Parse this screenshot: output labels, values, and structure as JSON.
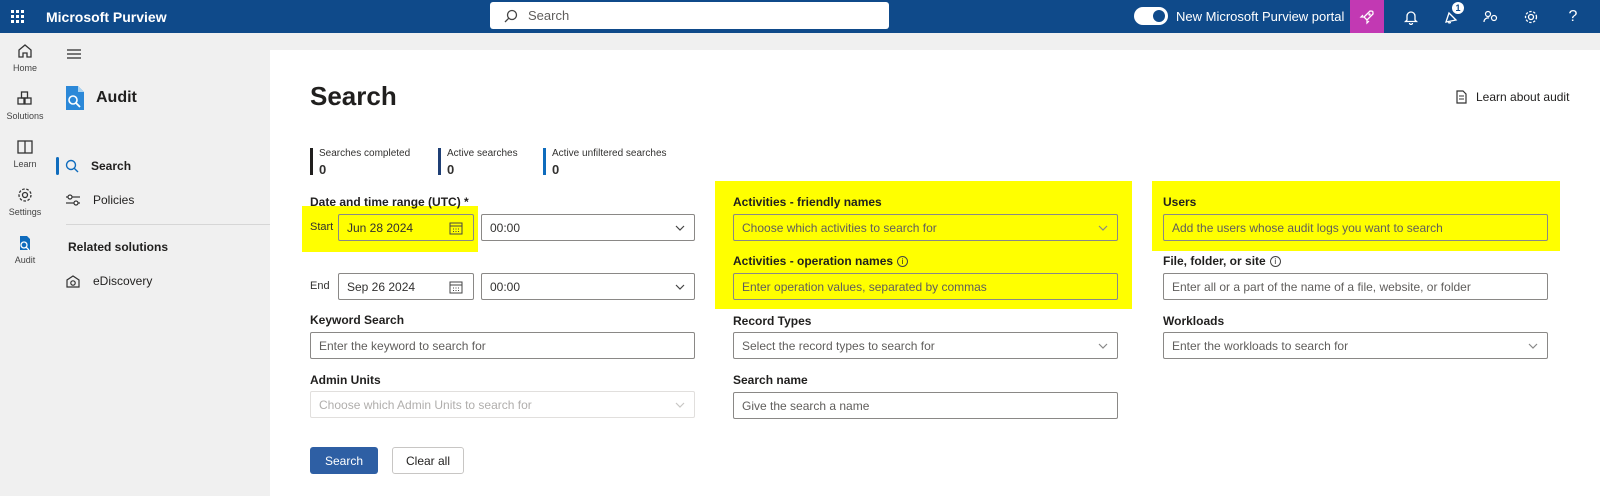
{
  "topbar": {
    "brand": "Microsoft Purview",
    "search_placeholder": "Search",
    "portal_toggle_label": "New Microsoft Purview portal",
    "notification_count": "1"
  },
  "rail": {
    "items": [
      {
        "label": "Home"
      },
      {
        "label": "Solutions"
      },
      {
        "label": "Learn"
      },
      {
        "label": "Settings"
      },
      {
        "label": "Audit"
      }
    ]
  },
  "nav": {
    "title": "Audit",
    "items": [
      {
        "label": "Search"
      },
      {
        "label": "Policies"
      }
    ],
    "related_heading": "Related solutions",
    "related_items": [
      {
        "label": "eDiscovery"
      }
    ]
  },
  "main": {
    "title": "Search",
    "learn_link": "Learn about audit",
    "stats": [
      {
        "label": "Searches completed",
        "value": "0"
      },
      {
        "label": "Active searches",
        "value": "0"
      },
      {
        "label": "Active unfiltered searches",
        "value": "0"
      }
    ],
    "date_range_label": "Date and time range (UTC) *",
    "start_label": "Start",
    "start_date": "Jun 28 2024",
    "start_time": "00:00",
    "end_label": "End",
    "end_date": "Sep 26 2024",
    "end_time": "00:00",
    "keyword_label": "Keyword Search",
    "keyword_placeholder": "Enter the keyword to search for",
    "admin_units_label": "Admin Units",
    "admin_units_placeholder": "Choose which Admin Units to search for",
    "activities_friendly_label": "Activities - friendly names",
    "activities_friendly_placeholder": "Choose which activities to search for",
    "activities_operation_label": "Activities - operation names",
    "activities_operation_placeholder": "Enter operation values, separated by commas",
    "record_types_label": "Record Types",
    "record_types_placeholder": "Select the record types to search for",
    "search_name_label": "Search name",
    "search_name_placeholder": "Give the search a name",
    "users_label": "Users",
    "users_placeholder": "Add the users whose audit logs you want to search",
    "file_label": "File, folder, or site",
    "file_placeholder": "Enter all or a part of the name of a file, website, or folder",
    "workloads_label": "Workloads",
    "workloads_placeholder": "Enter the workloads to search for",
    "search_button": "Search",
    "clear_button": "Clear all",
    "info_glyph": "i"
  },
  "colors": {
    "topbar": "#0f4a8a",
    "accent": "#0f6cbd",
    "highlight": "#ffff00",
    "primary_button": "#2e5fa4"
  }
}
